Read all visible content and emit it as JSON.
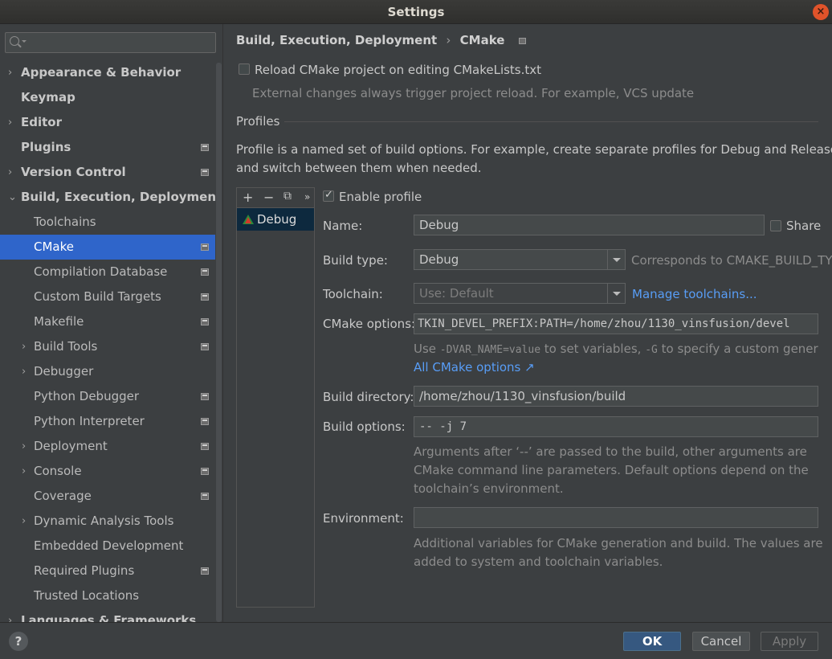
{
  "window": {
    "title": "Settings"
  },
  "search": {
    "placeholder": ""
  },
  "sidebar": {
    "items": [
      {
        "label": "Appearance & Behavior",
        "level": 0,
        "arrow": "›",
        "proj": false
      },
      {
        "label": "Keymap",
        "level": 0,
        "arrow": "",
        "proj": false
      },
      {
        "label": "Editor",
        "level": 0,
        "arrow": "›",
        "proj": false
      },
      {
        "label": "Plugins",
        "level": 0,
        "arrow": "",
        "proj": true
      },
      {
        "label": "Version Control",
        "level": 0,
        "arrow": "›",
        "proj": true
      },
      {
        "label": "Build, Execution, Deployment",
        "level": 0,
        "arrow": "⌄",
        "proj": false
      },
      {
        "label": "Toolchains",
        "level": 1,
        "arrow": "",
        "proj": false
      },
      {
        "label": "CMake",
        "level": 1,
        "arrow": "",
        "proj": true,
        "selected": true
      },
      {
        "label": "Compilation Database",
        "level": 1,
        "arrow": "",
        "proj": true
      },
      {
        "label": "Custom Build Targets",
        "level": 1,
        "arrow": "",
        "proj": true
      },
      {
        "label": "Makefile",
        "level": 1,
        "arrow": "",
        "proj": true
      },
      {
        "label": "Build Tools",
        "level": 1,
        "arrow": "›",
        "proj": true
      },
      {
        "label": "Debugger",
        "level": 1,
        "arrow": "›",
        "proj": false
      },
      {
        "label": "Python Debugger",
        "level": 1,
        "arrow": "",
        "proj": true
      },
      {
        "label": "Python Interpreter",
        "level": 1,
        "arrow": "",
        "proj": true
      },
      {
        "label": "Deployment",
        "level": 1,
        "arrow": "›",
        "proj": true
      },
      {
        "label": "Console",
        "level": 1,
        "arrow": "›",
        "proj": true
      },
      {
        "label": "Coverage",
        "level": 1,
        "arrow": "",
        "proj": true
      },
      {
        "label": "Dynamic Analysis Tools",
        "level": 1,
        "arrow": "›",
        "proj": false
      },
      {
        "label": "Embedded Development",
        "level": 1,
        "arrow": "",
        "proj": false
      },
      {
        "label": "Required Plugins",
        "level": 1,
        "arrow": "",
        "proj": true
      },
      {
        "label": "Trusted Locations",
        "level": 1,
        "arrow": "",
        "proj": false
      },
      {
        "label": "Languages & Frameworks",
        "level": 0,
        "arrow": "›",
        "proj": false
      }
    ]
  },
  "breadcrumb": {
    "parent": "Build, Execution, Deployment",
    "separator": "›",
    "current": "CMake"
  },
  "reload": {
    "label": "Reload CMake project on editing CMakeLists.txt",
    "checked": false,
    "hint": "External changes always trigger project reload. For example, VCS update"
  },
  "profiles": {
    "section_title": "Profiles",
    "description_line1": "Profile is a named set of build options. For example, create separate profiles for Debug and Release builds",
    "description_line2": "and switch between them when needed.",
    "toolbar": {
      "add": "+",
      "remove": "−",
      "copy": "⧉",
      "more": "»"
    },
    "list": [
      "Debug"
    ]
  },
  "form": {
    "enable_profile_label": "Enable profile",
    "enable_profile_checked": true,
    "name_label": "Name:",
    "name_value": "Debug",
    "share_label": "Share",
    "build_type_label": "Build type:",
    "build_type_value": "Debug",
    "build_type_hint": "Corresponds to CMAKE_BUILD_TYPE",
    "toolchain_label": "Toolchain:",
    "toolchain_value": "Use: Default",
    "manage_toolchains": "Manage toolchains...",
    "cmake_options_label": "CMake options:",
    "cmake_options_value": "TKIN_DEVEL_PREFIX:PATH=/home/zhou/1130_vinsfusion/devel",
    "cmake_hint_use": "Use ",
    "cmake_hint_code1": "-DVAR_NAME=value",
    "cmake_hint_mid": " to set variables, ",
    "cmake_hint_code2": "-G",
    "cmake_hint_end": " to specify a custom generator",
    "all_cmake_options": "All CMake options ↗",
    "build_directory_label": "Build directory:",
    "build_directory_value": "/home/zhou/1130_vinsfusion/build",
    "build_options_label": "Build options:",
    "build_options_value": "-- -j 7",
    "build_options_hint1": "Arguments after ‘--’ are passed to the build, other arguments are",
    "build_options_hint2": "CMake command line parameters. Default options depend on the",
    "build_options_hint3": "toolchain’s environment.",
    "environment_label": "Environment:",
    "environment_value": "",
    "environment_hint1": "Additional variables for CMake generation and build. The values are",
    "environment_hint2": "added to system and toolchain variables."
  },
  "footer": {
    "help": "?",
    "ok": "OK",
    "cancel": "Cancel",
    "apply": "Apply"
  }
}
